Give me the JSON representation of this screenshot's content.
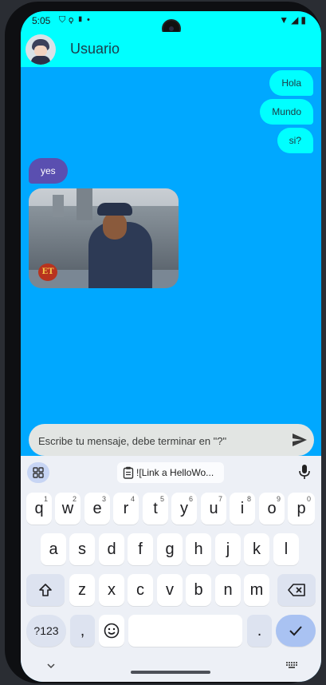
{
  "status_bar": {
    "time": "5:05"
  },
  "app_bar": {
    "title": "Usuario"
  },
  "messages": [
    {
      "text": "Hola",
      "from": "me"
    },
    {
      "text": "Mundo",
      "from": "me"
    },
    {
      "text": "si?",
      "from": "me"
    },
    {
      "text": "yes",
      "from": "other"
    }
  ],
  "image_message": {
    "logo_text": "ET"
  },
  "composer": {
    "placeholder": "Escribe tu mensaje, debe terminar en \"?\""
  },
  "keyboard": {
    "clipboard_suggestion": "![Link a HelloWo...",
    "row1": [
      "q",
      "w",
      "e",
      "r",
      "t",
      "y",
      "u",
      "i",
      "o",
      "p"
    ],
    "row1_hints": [
      "1",
      "2",
      "3",
      "4",
      "5",
      "6",
      "7",
      "8",
      "9",
      "0"
    ],
    "row2": [
      "a",
      "s",
      "d",
      "f",
      "g",
      "h",
      "j",
      "k",
      "l"
    ],
    "row3": [
      "z",
      "x",
      "c",
      "v",
      "b",
      "n",
      "m"
    ],
    "symbols_label": "?123",
    "comma": ",",
    "period": "."
  },
  "colors": {
    "app_bar": "#00ffff",
    "chat_bg": "#00a8ff",
    "other_bubble": "#5a4fb0",
    "my_bubble": "#00ffff"
  },
  "icons": [
    "shield-icon",
    "usb-icon",
    "sim-icon",
    "wifi-icon",
    "signal-icon",
    "battery-icon",
    "send-icon",
    "apps-grid-icon",
    "clipboard-icon",
    "mic-icon",
    "shift-icon",
    "backspace-icon",
    "emoji-icon",
    "check-icon",
    "chevron-down-icon",
    "keyboard-icon"
  ]
}
